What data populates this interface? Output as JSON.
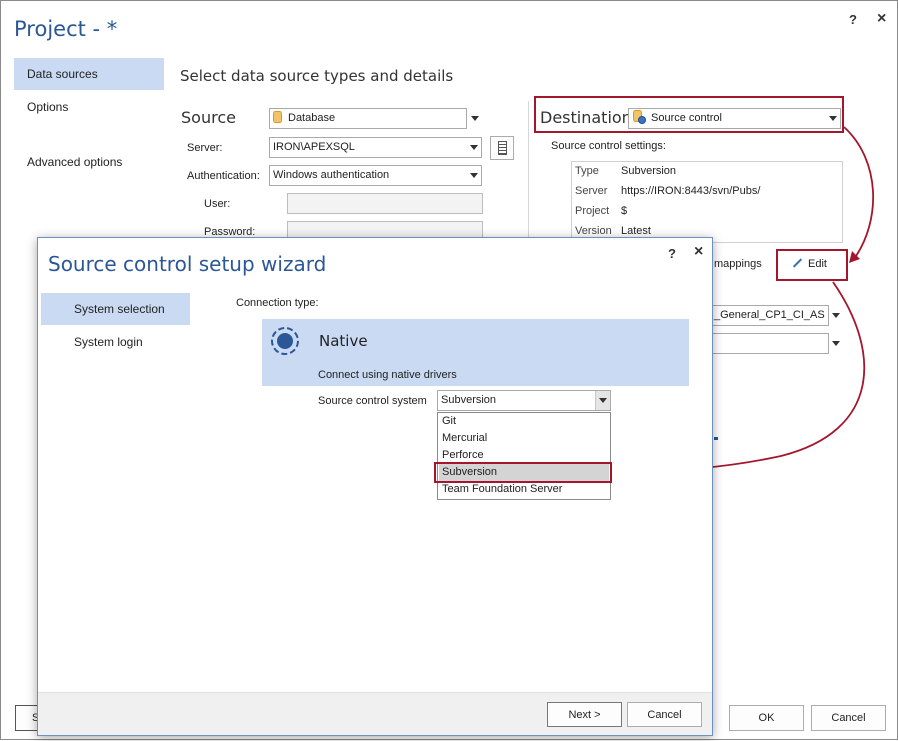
{
  "window": {
    "title": "Project - *",
    "help": "?",
    "close": "×"
  },
  "nav": {
    "items": [
      {
        "label": "Data sources"
      },
      {
        "label": "Options"
      },
      {
        "label": "Advanced options"
      }
    ]
  },
  "main": {
    "heading": "Select data source types and details",
    "source": {
      "heading": "Source",
      "type_value": "Database",
      "server_label": "Server:",
      "server_value": "IRON\\APEXSQL",
      "auth_label": "Authentication:",
      "auth_value": "Windows authentication",
      "user_label": "User:",
      "password_label": "Password:"
    },
    "destination": {
      "heading": "Destination",
      "type_value": "Source control",
      "settings_label": "Source control settings:",
      "settings": [
        {
          "key": "Type",
          "value": "Subversion"
        },
        {
          "key": "Server",
          "value": "https://IRON:8443/svn/Pubs/"
        },
        {
          "key": "Project",
          "value": "$"
        },
        {
          "key": "Version",
          "value": "Latest"
        }
      ],
      "mappings_partial": "mappings",
      "edit_label": "Edit",
      "collation_partial": "_General_CP1_CI_AS"
    },
    "footer": {
      "ok_label": "OK",
      "cancel_label": "Cancel",
      "left_partial": "S"
    }
  },
  "wizard": {
    "title": "Source control setup wizard",
    "help": "?",
    "close": "×",
    "nav": [
      {
        "label": "System selection"
      },
      {
        "label": "System login"
      }
    ],
    "connection_type_label": "Connection type:",
    "native_title": "Native",
    "native_desc": "Connect using native drivers",
    "scs_label": "Source control system",
    "scs_value": "Subversion",
    "options": [
      "Git",
      "Mercurial",
      "Perforce",
      "Subversion",
      "Team Foundation Server"
    ],
    "selected_option": "Subversion",
    "next_label": "Next >",
    "cancel_label": "Cancel"
  },
  "colors": {
    "accent": "#2b5797",
    "selection": "#c9daf2",
    "highlight_red": "#a4162b"
  }
}
